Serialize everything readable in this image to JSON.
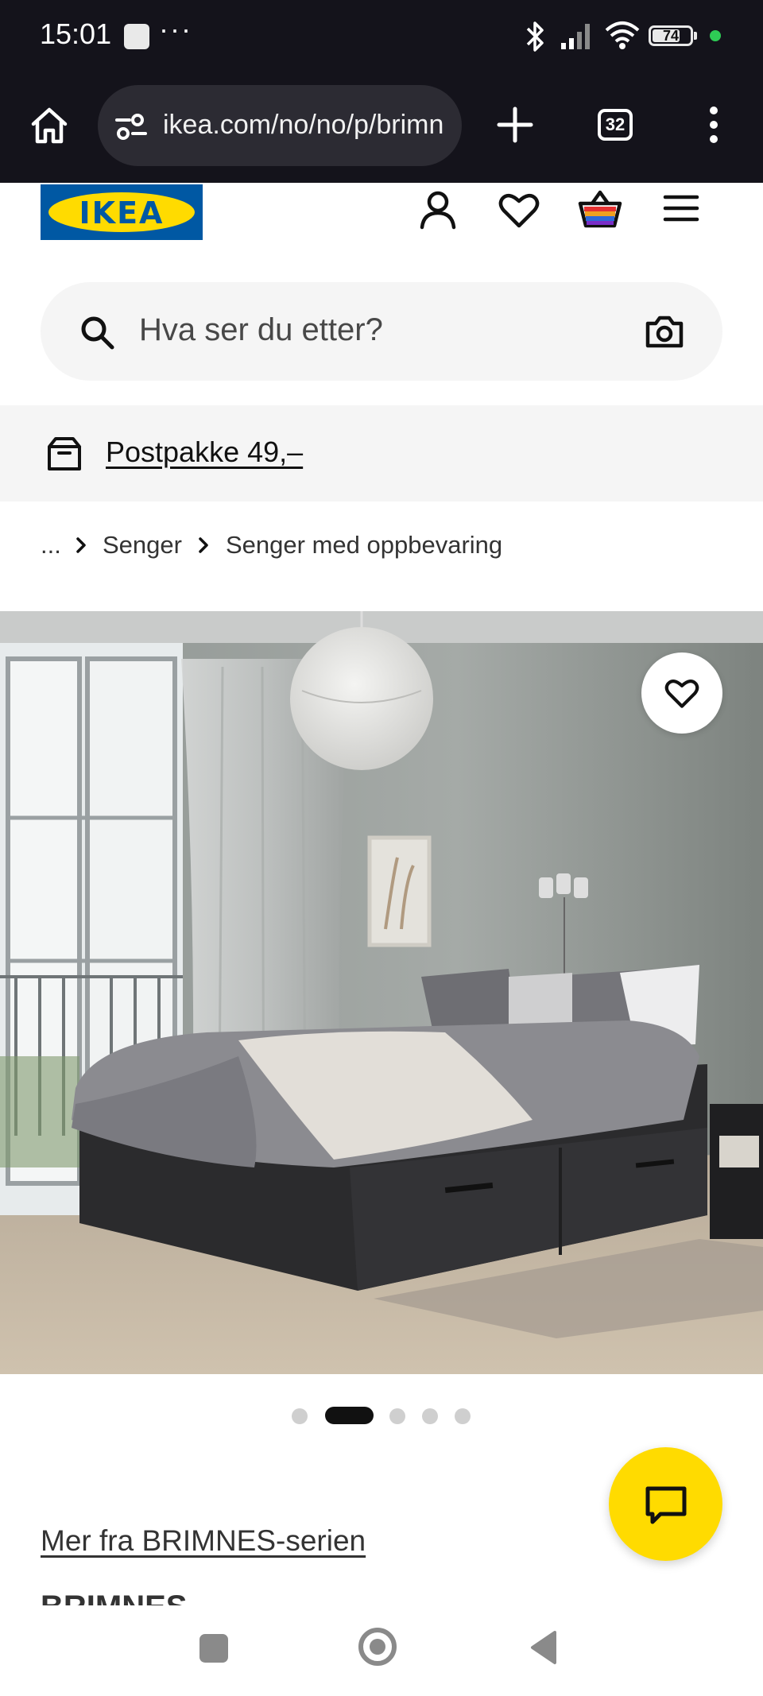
{
  "status_bar": {
    "time": "15:01",
    "dots": "···",
    "battery": "74"
  },
  "browser": {
    "url": "ikea.com/no/no/p/brimn",
    "tab_count": "32"
  },
  "header": {
    "logo_text": "IKEA",
    "colors": {
      "brand_blue": "#0058a3",
      "brand_yellow": "#ffdb00"
    }
  },
  "search": {
    "placeholder": "Hva ser du etter?"
  },
  "promo": {
    "text": "Postpakke 49,–"
  },
  "breadcrumb": {
    "ellipsis": "...",
    "items": [
      "Senger",
      "Senger med oppbevaring"
    ]
  },
  "gallery": {
    "active_index": 1,
    "count": 5
  },
  "product": {
    "series_link": "Mer fra BRIMNES-serien",
    "name": "BRIMNES"
  },
  "icons": [
    "home-icon",
    "site-settings-icon",
    "plus-icon",
    "tabs-icon",
    "more-vert-icon",
    "account-icon",
    "heart-icon",
    "basket-icon",
    "menu-icon",
    "search-icon",
    "camera-icon",
    "parcel-icon",
    "chevron-right-icon",
    "chat-icon"
  ]
}
